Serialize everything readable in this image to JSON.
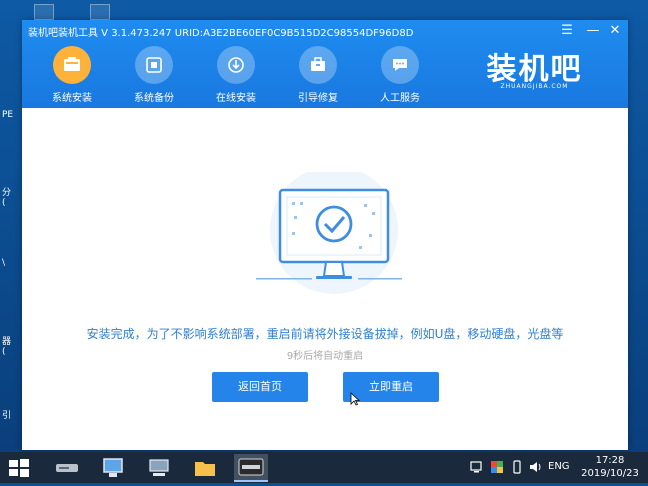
{
  "window": {
    "title": "装机吧装机工具 V 3.1.473.247 URID:A3E2BE60EF0C9B515D2C98554DF96D8D",
    "menu_glyph": "☰",
    "minimize_glyph": "—",
    "close_glyph": "✕"
  },
  "nav": {
    "items": [
      {
        "label": "系统安装",
        "icon": "system-install-icon",
        "active": true
      },
      {
        "label": "系统备份",
        "icon": "system-backup-icon",
        "active": false
      },
      {
        "label": "在线安装",
        "icon": "online-install-icon",
        "active": false
      },
      {
        "label": "引导修复",
        "icon": "boot-repair-icon",
        "active": false
      },
      {
        "label": "人工服务",
        "icon": "chat-service-icon",
        "active": false
      }
    ]
  },
  "logo": {
    "text": "装机吧",
    "subtext": "ZHUANGJIBA.COM"
  },
  "content": {
    "message": "安装完成，为了不影响系统部署，重启前请将外接设备拔掉，例如U盘，移动硬盘，光盘等",
    "countdown": "9秒后将自动重启",
    "back_label": "返回首页",
    "restart_label": "立即重启"
  },
  "desktop": {
    "side_labels": [
      "PE",
      "分",
      "(",
      "\\",
      "器",
      "(",
      "引"
    ]
  },
  "taskbar": {
    "lang": "ENG",
    "time": "17:28",
    "date": "2019/10/23"
  },
  "colors": {
    "accent": "#2484ea",
    "titlebar": "#1978e0",
    "active_nav": "#ffb23a",
    "message": "#2f7fd3"
  }
}
